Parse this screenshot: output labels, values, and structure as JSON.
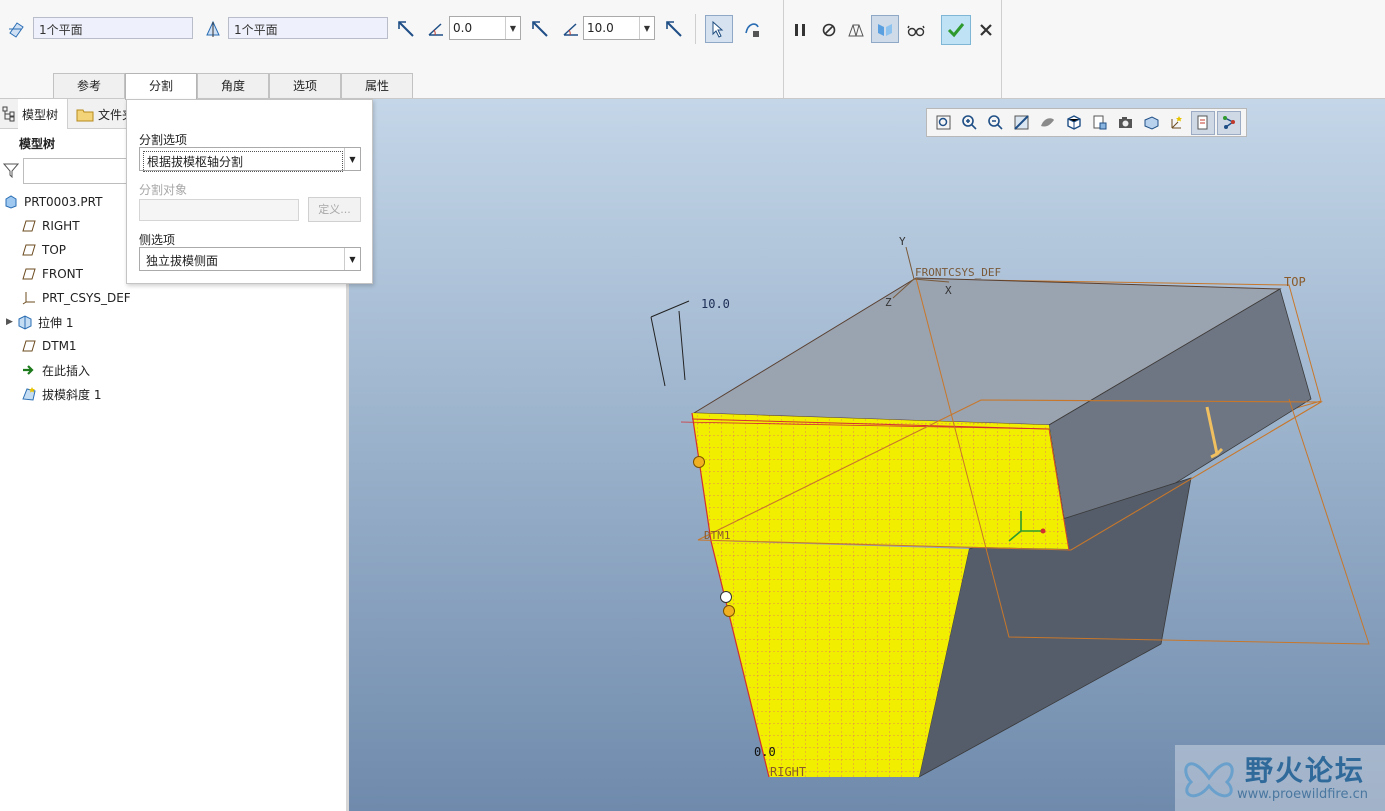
{
  "dashboard": {
    "split1_ref": "1个平面",
    "split2_ref": "1个平面",
    "angle1_value": "0.0",
    "angle2_value": "10.0",
    "tabs": [
      "参考",
      "分割",
      "角度",
      "选项",
      "属性"
    ],
    "active_tab": "分割"
  },
  "navigator": {
    "tabs": [
      "模型树",
      "文件夹"
    ],
    "tree_header": "模型树",
    "items": [
      "PRT0003.PRT",
      "RIGHT",
      "TOP",
      "FRONT",
      "PRT_CSYS_DEF",
      "拉伸 1",
      "DTM1",
      "在此插入",
      "拔模斜度 1"
    ]
  },
  "split_panel": {
    "split_options_label": "分割选项",
    "split_options_value": "根据拔模枢轴分割",
    "split_object_label": "分割对象",
    "define_button": "定义...",
    "side_options_label": "侧选项",
    "side_options_value": "独立拔模侧面"
  },
  "graphics": {
    "labels": {
      "y_axis": "Y",
      "x_axis": "X",
      "z_axis": "Z",
      "csys": "FRONTCSYS_DEF",
      "top": "TOP",
      "right": "RIGHT",
      "dtm": "DTM1",
      "angle_top": "10.0",
      "angle_bottom": "0.0"
    },
    "watermark": {
      "title": "野火论坛",
      "url": "www.proewildfire.cn"
    },
    "colors": {
      "draft_surface": "#f2ee00",
      "datum_line": "#c8772a"
    }
  }
}
